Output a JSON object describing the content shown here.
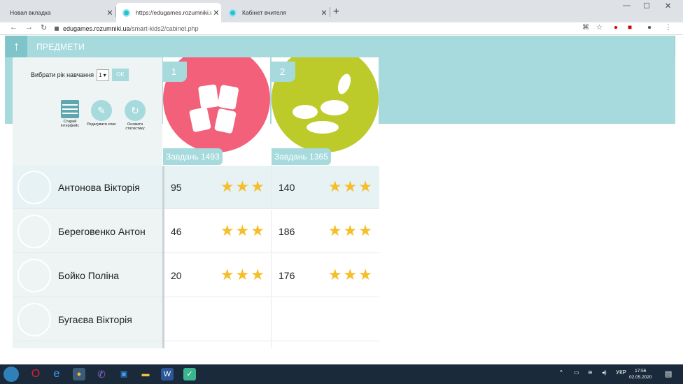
{
  "browser": {
    "tabs": [
      {
        "title": "Новая вкладка",
        "active": false
      },
      {
        "title": "https://edugames.rozumniki.ua/",
        "active": true
      },
      {
        "title": "Кабінет вчителя",
        "active": false
      }
    ],
    "url_host": "edugames.rozumniki.ua",
    "url_path": "/smart-kids2/cabinet.php"
  },
  "header": {
    "title": "ПРЕДМЕТИ"
  },
  "controls": {
    "grade_label": "Вибрати рік навчання",
    "grade_value": "1",
    "ok_label": "OK",
    "tools": [
      {
        "label": "Старий інтерфейс",
        "icon": "table-icon"
      },
      {
        "label": "Редагувати клас",
        "icon": "pencil-icon"
      },
      {
        "label": "Оновити статистику",
        "icon": "refresh-icon"
      }
    ]
  },
  "subjects": [
    {
      "number": "1",
      "tasks": "Завдань 1493",
      "color": "#f2607a",
      "icon": "math-cards-icon"
    },
    {
      "number": "2",
      "tasks": "Завдань 1365",
      "color": "#bccb2a",
      "icon": "nature-icon"
    }
  ],
  "students": [
    {
      "name": "Антонова Вікторія",
      "scores": [
        "95",
        "140"
      ],
      "highlighted": true
    },
    {
      "name": "Береговенко Антон",
      "scores": [
        "46",
        "186"
      ],
      "highlighted": false
    },
    {
      "name": "Бойко Поліна",
      "scores": [
        "20",
        "176"
      ],
      "highlighted": false
    },
    {
      "name": "Бугаєва Вікторія",
      "scores": [
        "",
        ""
      ],
      "highlighted": false
    }
  ],
  "taskbar": {
    "lang": "УКР",
    "time": "17:56",
    "date": "02.05.2020"
  },
  "colors": {
    "accent": "#a6dadd",
    "star": "#f5be2b"
  }
}
